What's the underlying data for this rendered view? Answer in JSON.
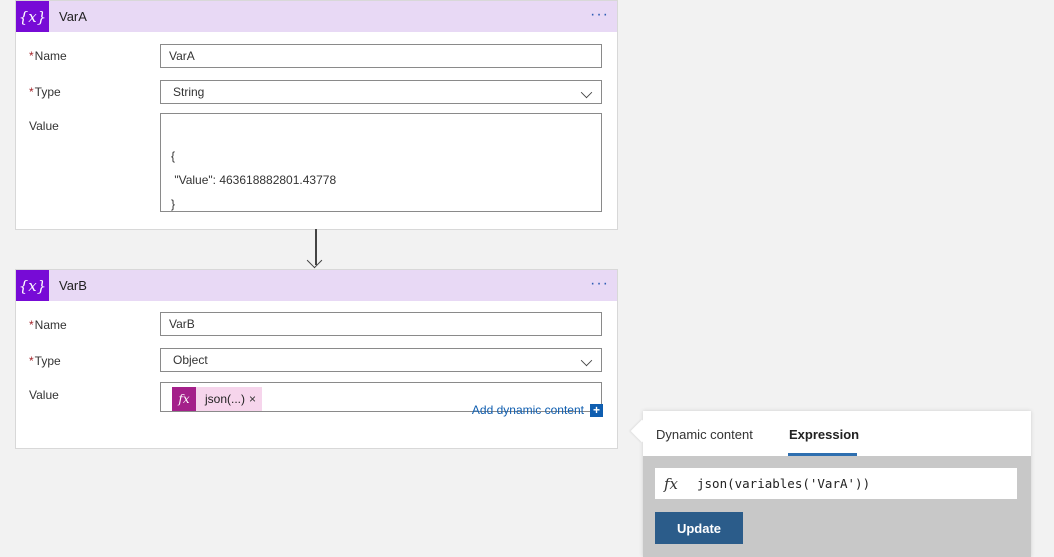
{
  "varA": {
    "icon": "{x}",
    "title": "VarA",
    "more": "···",
    "name_label": "Name",
    "name_value": "VarA",
    "type_label": "Type",
    "type_value": "String",
    "value_label": "Value",
    "value_lines": [
      "{",
      " \"Value\": 463618882801.43778",
      "}"
    ]
  },
  "varB": {
    "icon": "{x}",
    "title": "VarB",
    "more": "···",
    "name_label": "Name",
    "name_value": "VarB",
    "type_label": "Type",
    "type_value": "Object",
    "value_label": "Value",
    "token_icon": "fx",
    "token_label": "json(...)",
    "token_remove": "×",
    "add_dynamic": "Add dynamic content",
    "add_icon": "+"
  },
  "required_mark": "*",
  "popup": {
    "tabs": [
      "Dynamic content",
      "Expression"
    ],
    "active_tab": "Expression",
    "fx": "fx",
    "expression": "json(variables('VarA'))",
    "update_label": "Update"
  },
  "colors": {
    "accent_purple": "#770bd6",
    "header_bg": "#e8d9f5",
    "token_purple": "#a4208a",
    "link_blue": "#0f5eb0",
    "update_btn": "#2b5c8a"
  }
}
